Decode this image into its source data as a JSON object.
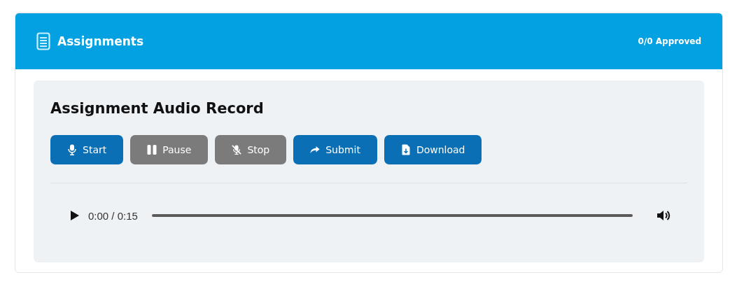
{
  "header": {
    "title": "Assignments",
    "status": "0/0 Approved"
  },
  "panel": {
    "title": "Assignment Audio Record",
    "buttons": [
      {
        "label": "Start",
        "kind": "mic",
        "disabled": false
      },
      {
        "label": "Pause",
        "kind": "pause",
        "disabled": true
      },
      {
        "label": "Stop",
        "kind": "mute",
        "disabled": true
      },
      {
        "label": "Submit",
        "kind": "share",
        "disabled": false
      },
      {
        "label": "Download",
        "kind": "download",
        "disabled": false
      }
    ],
    "player": {
      "time": "0:00 / 0:15"
    }
  }
}
